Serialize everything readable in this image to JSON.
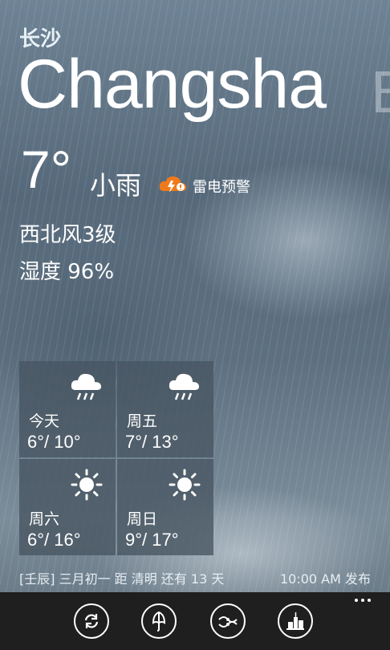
{
  "location": {
    "city_cn": "长沙",
    "city_en": "Changsha",
    "next_city_peek": "B"
  },
  "current": {
    "temperature": "7°",
    "condition": "小雨",
    "warning": "雷电预警",
    "wind": "西北风3级",
    "humidity": "湿度 96%"
  },
  "forecast": [
    {
      "day": "今天",
      "range": "6°/ 10°",
      "icon": "rain-cloud-icon"
    },
    {
      "day": "周五",
      "range": "7°/ 13°",
      "icon": "rain-cloud-icon"
    },
    {
      "day": "周六",
      "range": "6°/ 16°",
      "icon": "sun-icon"
    },
    {
      "day": "周日",
      "range": "9°/ 17°",
      "icon": "sun-icon"
    }
  ],
  "footer": {
    "lunar_info": "[壬辰] 三月初一 距 清明 还有 13 天",
    "published": "10:00 AM 发布"
  },
  "appbar": {
    "buttons": [
      "refresh-icon",
      "umbrella-icon",
      "trend-icon",
      "city-icon"
    ],
    "more": "more-dots-icon"
  },
  "colors": {
    "warning_orange": "#f07a1a",
    "appbar_bg": "#1f1f1f",
    "tile_bg": "#46545f"
  }
}
